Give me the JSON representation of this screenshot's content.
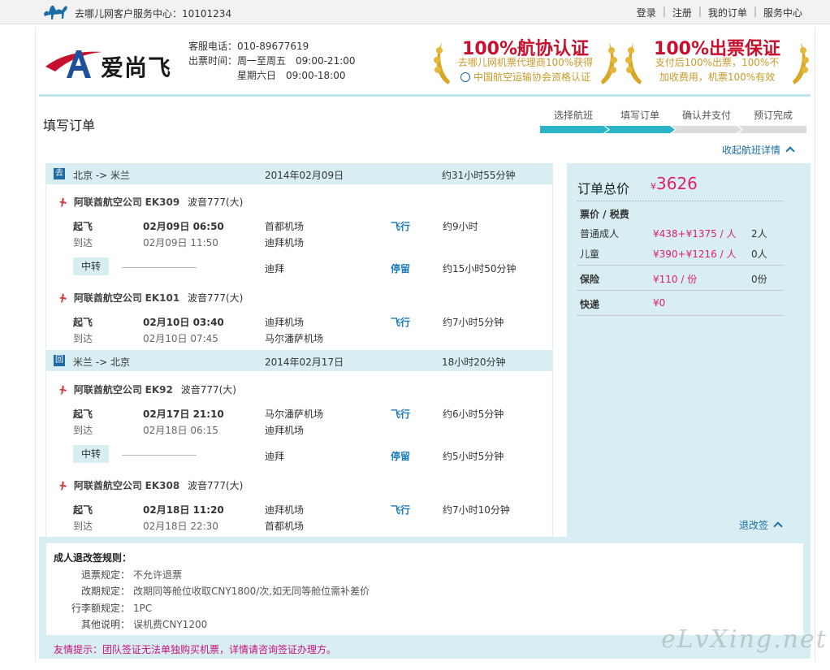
{
  "topbar": {
    "service_center": "去哪儿网客户服务中心：10101234",
    "links": [
      "登录",
      "注册",
      "我的订单",
      "服务中心"
    ]
  },
  "header": {
    "logo_text": "爱尚飞",
    "phone": "客服电话：010-89677619",
    "hours_label": "出票时间：",
    "hours_weekday": "周一至周五　09:00-21:00",
    "hours_weekend": "星期六日　09:00-18:00",
    "badge1": {
      "title": "100%航协认证",
      "sub1": "去哪儿网机票代理商100%获得",
      "sub2": "中国航空运输协会资格认证"
    },
    "badge2": {
      "title": "100%出票保证",
      "sub1": "支付后100%出票，100%不",
      "sub2": "加收费用，机票100%有效"
    }
  },
  "page_title": "填写订单",
  "steps": [
    "选择航班",
    "填写订单",
    "确认并支付",
    "预订完成"
  ],
  "collapse_label": "收起航班详情",
  "segments": [
    {
      "tag": "去",
      "route": "北京 -> 米兰",
      "date": "2014年02月09日",
      "duration": "约31小时55分钟",
      "flights": [
        {
          "airline": "阿联酋航空公司",
          "code": "EK309",
          "plane": "波音777(大)",
          "dep_label": "起飞",
          "dep_time": "02月09日  06:50",
          "dep_airport": "首都机场",
          "arr_label": "到达",
          "arr_time": "02月09日  11:50",
          "arr_airport": "迪拜机场",
          "status": "飞行",
          "time": "约9小时"
        },
        {
          "airline": "阿联酋航空公司",
          "code": "EK101",
          "plane": "波音777(大)",
          "dep_label": "起飞",
          "dep_time": "02月10日  03:40",
          "dep_airport": "迪拜机场",
          "arr_label": "到达",
          "arr_time": "02月10日  07:45",
          "arr_airport": "马尔潘萨机场",
          "status": "飞行",
          "time": "约7小时5分钟"
        }
      ],
      "transfer": {
        "label": "中转",
        "city": "迪拜",
        "status": "停留",
        "time": "约15小时50分钟"
      }
    },
    {
      "tag": "回",
      "route": "米兰 -> 北京",
      "date": "2014年02月17日",
      "duration": "18小时20分钟",
      "flights": [
        {
          "airline": "阿联酋航空公司",
          "code": "EK92",
          "plane": "波音777(大)",
          "dep_label": "起飞",
          "dep_time": "02月17日  21:10",
          "dep_airport": "马尔潘萨机场",
          "arr_label": "到达",
          "arr_time": "02月18日  06:15",
          "arr_airport": "迪拜机场",
          "status": "飞行",
          "time": "约6小时5分钟"
        },
        {
          "airline": "阿联酋航空公司",
          "code": "EK308",
          "plane": "波音777(大)",
          "dep_label": "起飞",
          "dep_time": "02月18日  11:20",
          "dep_airport": "迪拜机场",
          "arr_label": "到达",
          "arr_time": "02月18日  22:30",
          "arr_airport": "首都机场",
          "status": "飞行",
          "time": "约7小时10分钟"
        }
      ],
      "transfer": {
        "label": "中转",
        "city": "迪拜",
        "status": "停留",
        "time": "约5小时5分钟"
      }
    }
  ],
  "summary": {
    "title": "订单总价",
    "currency": "¥",
    "total": "3626",
    "fare_header": "票价 / 税费",
    "adult_label": "普通成人",
    "adult_price": "¥438+¥1375 / 人",
    "adult_count": "2人",
    "child_label": "儿童",
    "child_price": "¥390+¥1216 / 人",
    "child_count": "0人",
    "insurance_label": "保险",
    "insurance_price": "¥110 / 份",
    "insurance_count": "0份",
    "delivery_label": "快递",
    "delivery_price": "¥0"
  },
  "retro_label": "退改签",
  "rules": {
    "title": "成人退改签规则：",
    "items": [
      {
        "k": "退票规定：",
        "v": "不允许退票"
      },
      {
        "k": "改期规定：",
        "v": "改期同等舱位收取CNY1800/次,如无同等舱位需补差价"
      },
      {
        "k": "行李额规定：",
        "v": "1PC"
      },
      {
        "k": "其他说明：",
        "v": "误机费CNY1200"
      }
    ]
  },
  "tip": "友情提示：团队签证无法单独购买机票，详情请咨询签证办理方。",
  "watermark": "eLvXing.net",
  "colors": {
    "accent_blue": "#1a7bbd",
    "panel_bg": "#d8eef3",
    "price_pink": "#e0206a",
    "brand_red": "#c8102e",
    "step_active": "#2bb3c7"
  }
}
